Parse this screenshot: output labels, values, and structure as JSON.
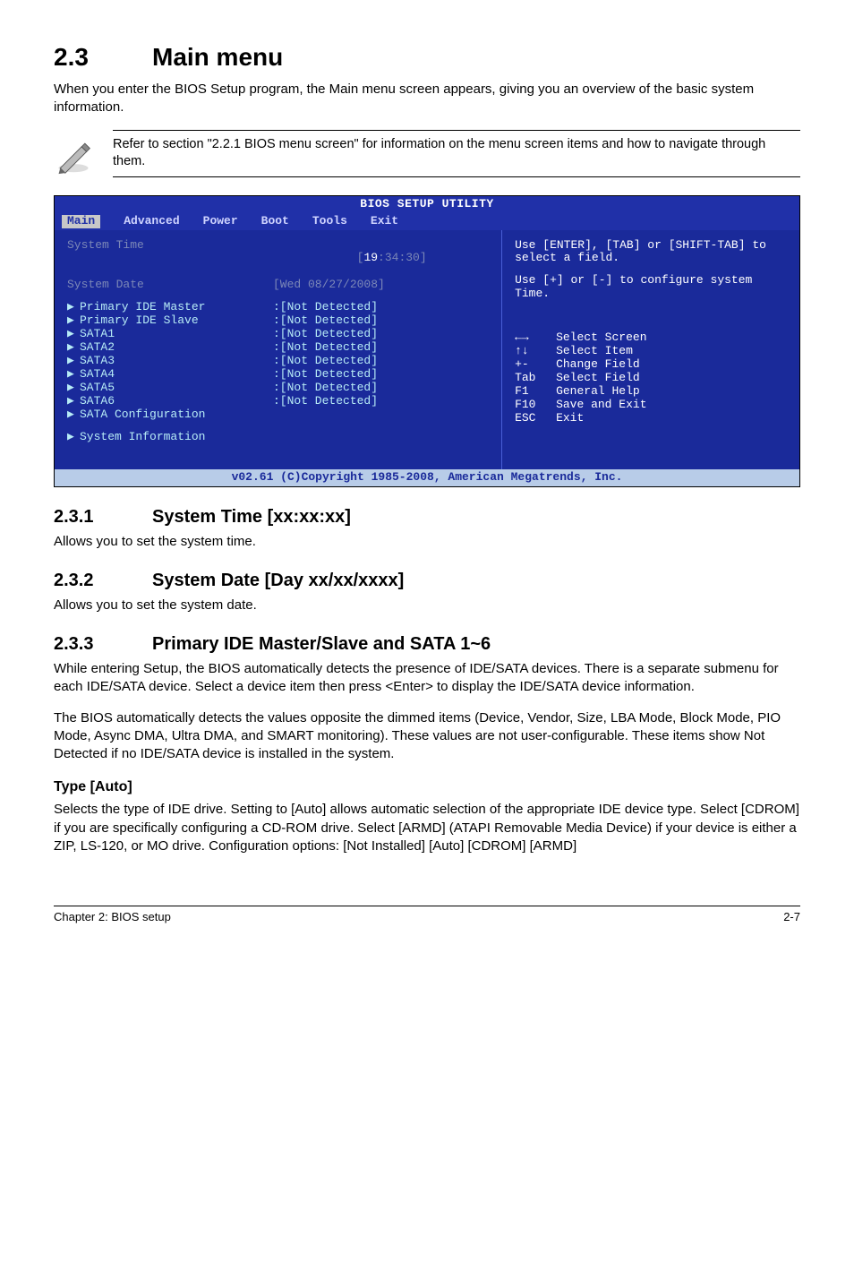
{
  "section": {
    "num": "2.3",
    "title": "Main menu",
    "intro": "When you enter the BIOS Setup program, the Main menu screen appears, giving you an overview of the basic system information.",
    "note": "Refer to section \"2.2.1 BIOS menu screen\" for information on the menu screen items and how to navigate through them."
  },
  "bios": {
    "title": "BIOS SETUP UTILITY",
    "tabs": [
      "Main",
      "Advanced",
      "Power",
      "Boot",
      "Tools",
      "Exit"
    ],
    "system_time_label": "System Time",
    "system_time_value_pre": "[",
    "system_time_hh": "19",
    "system_time_rest": ":34:30]",
    "system_date_label": "System Date",
    "system_date_value": "[Wed 08/27/2008]",
    "items": [
      {
        "label": "Primary IDE Master",
        "value": ":[Not Detected]"
      },
      {
        "label": "Primary IDE Slave",
        "value": ":[Not Detected]"
      },
      {
        "label": "SATA1",
        "value": ":[Not Detected]"
      },
      {
        "label": "SATA2",
        "value": ":[Not Detected]"
      },
      {
        "label": "SATA3",
        "value": ":[Not Detected]"
      },
      {
        "label": "SATA4",
        "value": ":[Not Detected]"
      },
      {
        "label": "SATA5",
        "value": ":[Not Detected]"
      },
      {
        "label": "SATA6",
        "value": ":[Not Detected]"
      },
      {
        "label": "SATA Configuration",
        "value": ""
      }
    ],
    "sysinfo": "System Information",
    "help1": "Use [ENTER], [TAB] or [SHIFT-TAB] to select a field.",
    "help2": "Use [+] or [-] to configure system Time.",
    "keys": [
      {
        "k": "←→",
        "d": "Select Screen"
      },
      {
        "k": "↑↓",
        "d": "Select Item"
      },
      {
        "k": "+-",
        "d": "Change Field"
      },
      {
        "k": "Tab",
        "d": "Select Field"
      },
      {
        "k": "F1",
        "d": "General Help"
      },
      {
        "k": "F10",
        "d": "Save and Exit"
      },
      {
        "k": "ESC",
        "d": "Exit"
      }
    ],
    "footer": "v02.61 (C)Copyright 1985-2008, American Megatrends, Inc."
  },
  "sub1": {
    "num": "2.3.1",
    "title": "System Time [xx:xx:xx]",
    "body": "Allows you to set the system time."
  },
  "sub2": {
    "num": "2.3.2",
    "title": "System Date [Day xx/xx/xxxx]",
    "body": "Allows you to set the system date."
  },
  "sub3": {
    "num": "2.3.3",
    "title": "Primary IDE Master/Slave and SATA 1~6",
    "p1": "While entering Setup, the BIOS automatically detects the presence of IDE/SATA devices. There is a separate submenu for each IDE/SATA device. Select a device item then press <Enter> to display the IDE/SATA device information.",
    "p2": "The BIOS automatically detects the values opposite the dimmed items (Device, Vendor, Size, LBA Mode, Block Mode, PIO Mode, Async DMA, Ultra DMA, and SMART monitoring). These values are not user-configurable. These items show Not Detected if no IDE/SATA device is installed in the system."
  },
  "type": {
    "heading": "Type [Auto]",
    "body": "Selects the type of IDE drive. Setting to [Auto] allows automatic selection of the appropriate IDE device type. Select [CDROM] if you are specifically configuring a CD-ROM drive. Select [ARMD] (ATAPI Removable Media Device) if your device is either a ZIP, LS-120, or MO drive. Configuration options: [Not Installed] [Auto] [CDROM] [ARMD]"
  },
  "pagefoot": {
    "left": "Chapter 2: BIOS setup",
    "right": "2-7"
  }
}
